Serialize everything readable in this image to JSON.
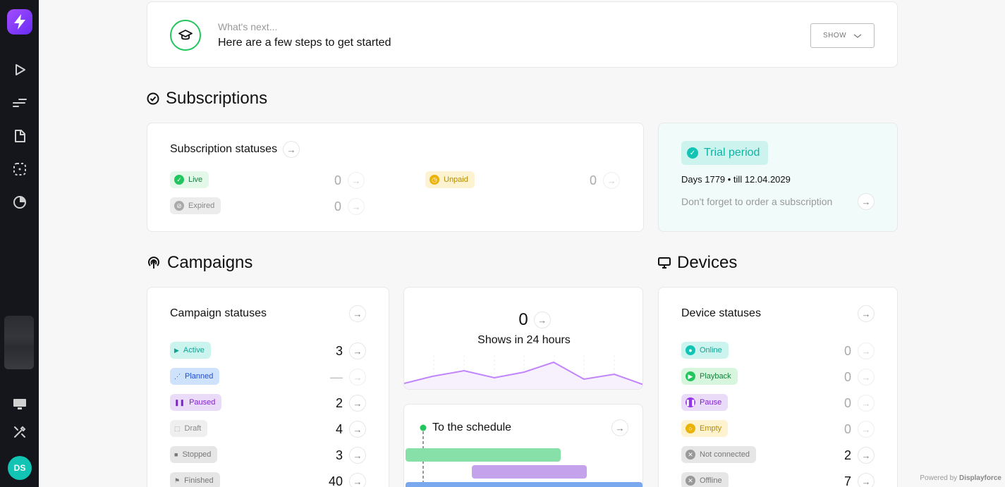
{
  "sidebar": {
    "avatar": "DS",
    "icons": [
      "bolt-logo-icon",
      "play-icon",
      "list-icon",
      "file-icon",
      "dashed-square-icon",
      "pie-chart-icon",
      "monitor-icon",
      "tools-icon"
    ]
  },
  "whats_next": {
    "subtitle": "What's next...",
    "title": "Here are a few steps to get started",
    "show_label": "SHOW"
  },
  "subscriptions": {
    "section_title": "Subscriptions",
    "card_title": "Subscription statuses",
    "rows": [
      {
        "label": "Live",
        "value": "0"
      },
      {
        "label": "Unpaid",
        "value": "0"
      },
      {
        "label": "Expired",
        "value": "0"
      }
    ],
    "trial": {
      "badge": "Trial period",
      "days": "Days 1779 • till 12.04.2029",
      "reminder": "Don't forget to order a subscription"
    }
  },
  "campaigns": {
    "section_title": "Campaigns",
    "card_title": "Campaign statuses",
    "rows": [
      {
        "label": "Active",
        "value": "3"
      },
      {
        "label": "Planned",
        "value": "—"
      },
      {
        "label": "Paused",
        "value": "2"
      },
      {
        "label": "Draft",
        "value": "4"
      },
      {
        "label": "Stopped",
        "value": "3"
      },
      {
        "label": "Finished",
        "value": "40"
      }
    ],
    "shows": {
      "value": "0",
      "label": "Shows in 24 hours"
    },
    "schedule": {
      "label": "To the schedule"
    }
  },
  "devices": {
    "section_title": "Devices",
    "card_title": "Device statuses",
    "rows": [
      {
        "label": "Online",
        "value": "0"
      },
      {
        "label": "Playback",
        "value": "0"
      },
      {
        "label": "Pause",
        "value": "0"
      },
      {
        "label": "Empty",
        "value": "0"
      },
      {
        "label": "Not connected",
        "value": "2"
      },
      {
        "label": "Offline",
        "value": "7"
      }
    ]
  },
  "footer": {
    "powered_prefix": "Powered by",
    "powered_brand": "Displayforce"
  },
  "colors": {
    "accent": "#12c4b4",
    "brand": "#7c3aed",
    "success": "#22c55e",
    "sparkline": "#c084fc"
  }
}
